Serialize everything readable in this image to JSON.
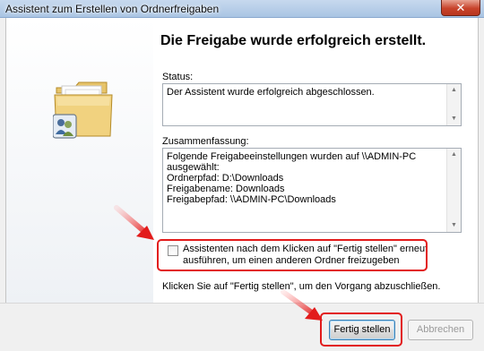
{
  "window": {
    "title": "Assistent zum Erstellen von Ordnerfreigaben",
    "close_glyph": "✕"
  },
  "heading": "Die Freigabe wurde erfolgreich erstellt.",
  "status": {
    "label": "Status:",
    "value": "Der Assistent wurde erfolgreich abgeschlossen."
  },
  "summary": {
    "label": "Zusammenfassung:",
    "lines": [
      "Folgende Freigabeeinstellungen wurden auf \\\\ADMIN-PC",
      "ausgewählt:",
      "Ordnerpfad: D:\\Downloads",
      "Freigabename: Downloads",
      "Freigabepfad: \\\\ADMIN-PC\\Downloads"
    ]
  },
  "rerun": {
    "label": "Assistenten nach dem Klicken auf \"Fertig stellen\" erneut ausführen, um einen anderen Ordner freizugeben",
    "checked": false
  },
  "instruction": "Klicken Sie auf \"Fertig stellen\", um den Vorgang abzuschließen.",
  "buttons": {
    "finish": "Fertig stellen",
    "cancel": "Abbrechen"
  },
  "icons": {
    "folder": "shared-folder-icon",
    "close": "close-icon",
    "scroll_up": "scroll-up-arrow-icon",
    "scroll_down": "scroll-down-arrow-icon",
    "annotation_arrow": "red-arrow-icon"
  },
  "colors": {
    "highlight": "#e21b1b",
    "title_bar": "#b8cfe9",
    "close_button": "#c7432b",
    "left_panel": "#eef1f5"
  }
}
